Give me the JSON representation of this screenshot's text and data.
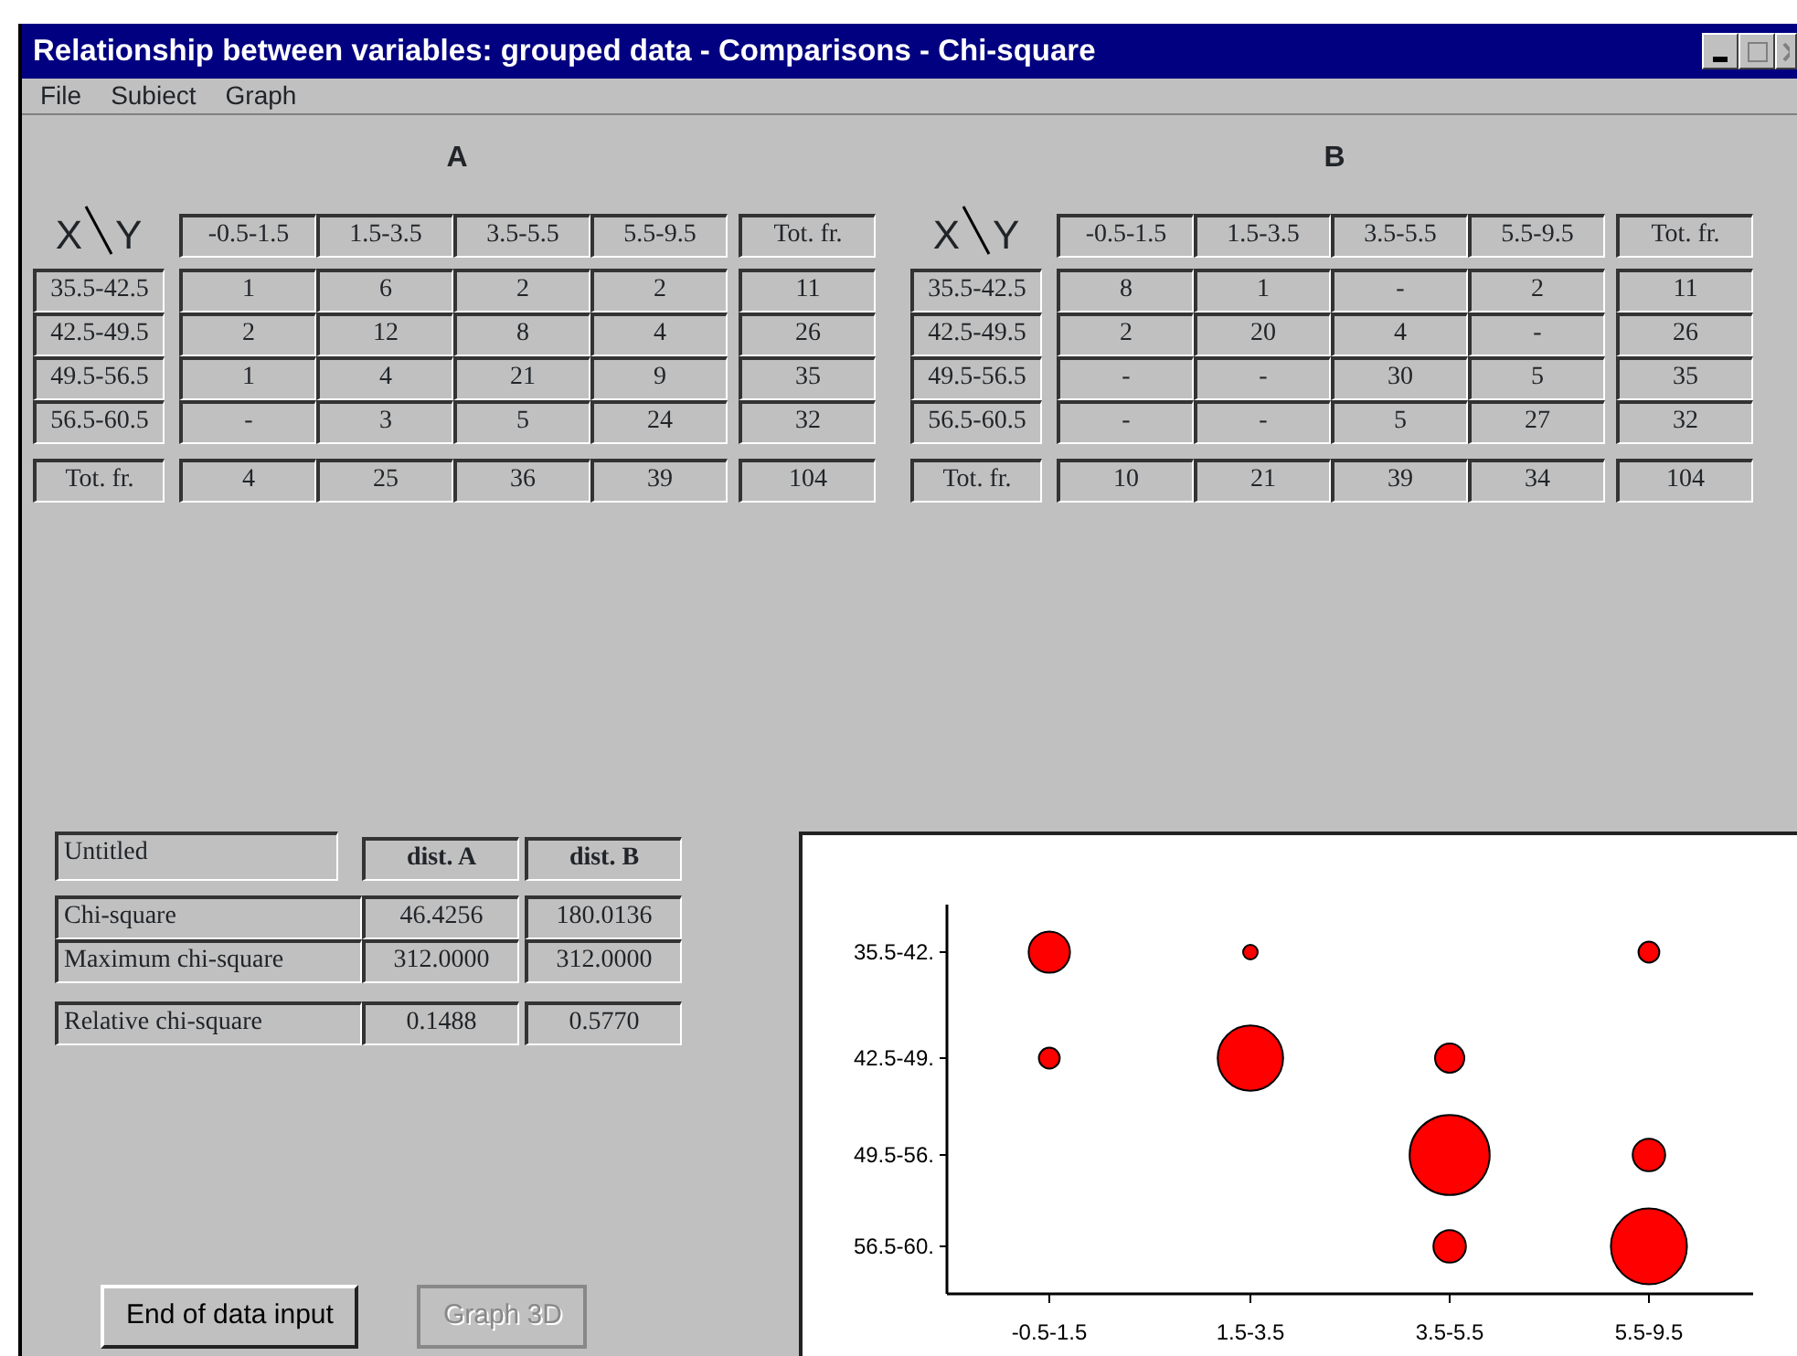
{
  "window": {
    "title": "Relationship between variables: grouped data - Comparisons - Chi-square"
  },
  "menu": [
    {
      "label": "File"
    },
    {
      "label": "Subiect"
    },
    {
      "label": "Graph"
    }
  ],
  "tables": [
    {
      "title": "A",
      "corner_x": "X",
      "corner_y": "Y",
      "columns": [
        "-0.5-1.5",
        "1.5-3.5",
        "3.5-5.5",
        "5.5-9.5"
      ],
      "total_header": "Tot. fr.",
      "rows": [
        {
          "label": "35.5-42.5",
          "cells": [
            "1",
            "6",
            "2",
            "2"
          ],
          "total": "11"
        },
        {
          "label": "42.5-49.5",
          "cells": [
            "2",
            "12",
            "8",
            "4"
          ],
          "total": "26"
        },
        {
          "label": "49.5-56.5",
          "cells": [
            "1",
            "4",
            "21",
            "9"
          ],
          "total": "35"
        },
        {
          "label": "56.5-60.5",
          "cells": [
            "-",
            "3",
            "5",
            "24"
          ],
          "total": "32"
        }
      ],
      "totals": {
        "label": "Tot. fr.",
        "cells": [
          "4",
          "25",
          "36",
          "39"
        ],
        "total": "104"
      }
    },
    {
      "title": "B",
      "corner_x": "X",
      "corner_y": "Y",
      "columns": [
        "-0.5-1.5",
        "1.5-3.5",
        "3.5-5.5",
        "5.5-9.5"
      ],
      "total_header": "Tot. fr.",
      "rows": [
        {
          "label": "35.5-42.5",
          "cells": [
            "8",
            "1",
            "-",
            "2"
          ],
          "total": "11"
        },
        {
          "label": "42.5-49.5",
          "cells": [
            "2",
            "20",
            "4",
            "-"
          ],
          "total": "26"
        },
        {
          "label": "49.5-56.5",
          "cells": [
            "-",
            "-",
            "30",
            "5"
          ],
          "total": "35"
        },
        {
          "label": "56.5-60.5",
          "cells": [
            "-",
            "-",
            "5",
            "27"
          ],
          "total": "32"
        }
      ],
      "totals": {
        "label": "Tot. fr.",
        "cells": [
          "10",
          "21",
          "39",
          "34"
        ],
        "total": "104"
      }
    }
  ],
  "chi_table": {
    "title": "Untitled",
    "columns": [
      "dist. A",
      "dist. B"
    ],
    "rows": [
      {
        "label": "Chi-square",
        "values": [
          "46.4256",
          "180.0136"
        ]
      },
      {
        "label": "Maximum chi-square",
        "values": [
          "312.0000",
          "312.0000"
        ]
      },
      {
        "label": "Relative chi-square",
        "values": [
          "0.1488",
          "0.5770"
        ]
      }
    ]
  },
  "buttons": [
    {
      "label": "End of data input",
      "disabled": false
    },
    {
      "label": "Graph 3D",
      "disabled": true
    }
  ],
  "chart": {
    "x_labels": [
      "-0.5-1.5",
      "1.5-3.5",
      "3.5-5.5",
      "5.5-9.5"
    ],
    "y_labels": [
      "35.5-42.",
      "42.5-49.",
      "49.5-56.",
      "56.5-60."
    ]
  }
}
